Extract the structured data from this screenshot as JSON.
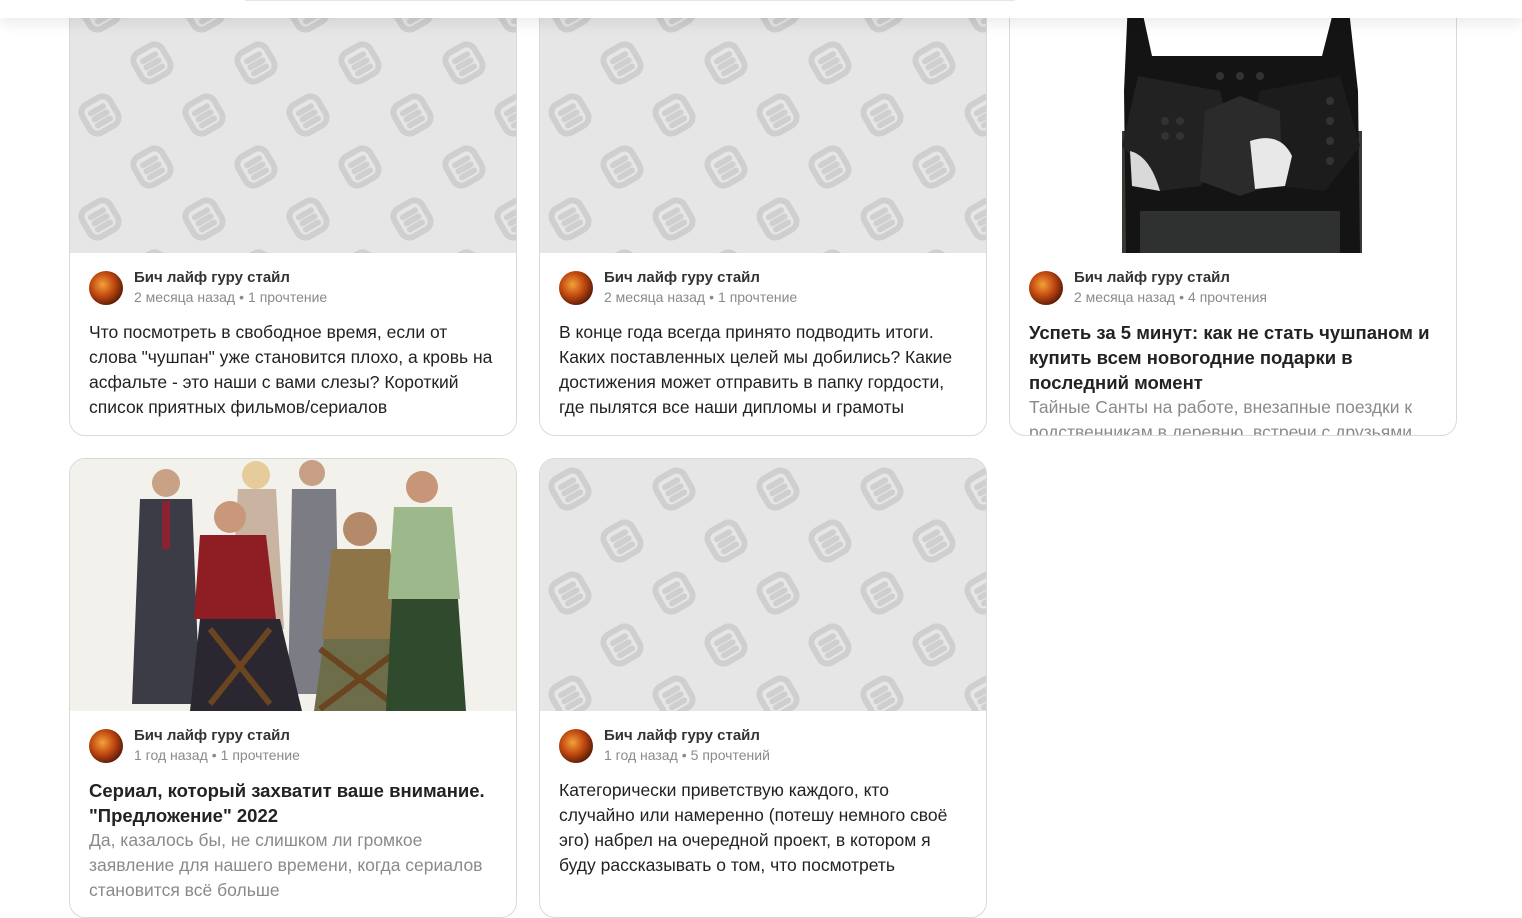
{
  "cards": [
    {
      "author": "Бич лайф гуру стайл",
      "age": "2 месяца назад",
      "reads": "1 прочтение",
      "title": "",
      "excerpt": "Что посмотреть в свободное время, если от слова \"чушпан\" уже становится плохо, а кровь на асфальте - это наши с вами слезы? Короткий список приятных фильмов/сериалов"
    },
    {
      "author": "Бич лайф гуру стайл",
      "age": "2 месяца назад",
      "reads": "1 прочтение",
      "title": "",
      "excerpt": "В конце года всегда принято подводить итоги. Каких поставленных целей мы добились? Какие достижения может отправить в папку гордости, где пылятся все наши дипломы и грамоты"
    },
    {
      "author": "Бич лайф гуру стайл",
      "age": "2 месяца назад",
      "reads": "4 прочтения",
      "title": "Успеть за 5 минут: как не стать чушпаном и купить всем новогодние подарки в последний момент",
      "excerpt": "Тайные Санты на работе, внезапные поездки к родственникам в деревню, встречи с друзьями"
    },
    {
      "author": "Бич лайф гуру стайл",
      "age": "1 год назад",
      "reads": "1 прочтение",
      "title": "Сериал, который захватит ваше внимание. \"Предложение\" 2022",
      "excerpt": "Да, казалось бы, не слишком ли громкое заявление для нашего времени, когда сериалов становится всё больше"
    },
    {
      "author": "Бич лайф гуру стайл",
      "age": "1 год назад",
      "reads": "5 прочтений",
      "title": "",
      "excerpt": "Категорически приветствую каждого, кто случайно или намеренно (потешу немного своё эго) набрел на очередной проект, в котором я буду рассказывать о том, что посмотреть"
    }
  ],
  "colors": {
    "placeholder_bg": "#e6e6e6",
    "placeholder_icon": "#cfcfcf",
    "meta_text": "#8a8a8a",
    "card_border": "#d9d9d9"
  },
  "icons": {
    "placeholder": "zen-logo-pattern",
    "avatar": "author-avatar"
  }
}
